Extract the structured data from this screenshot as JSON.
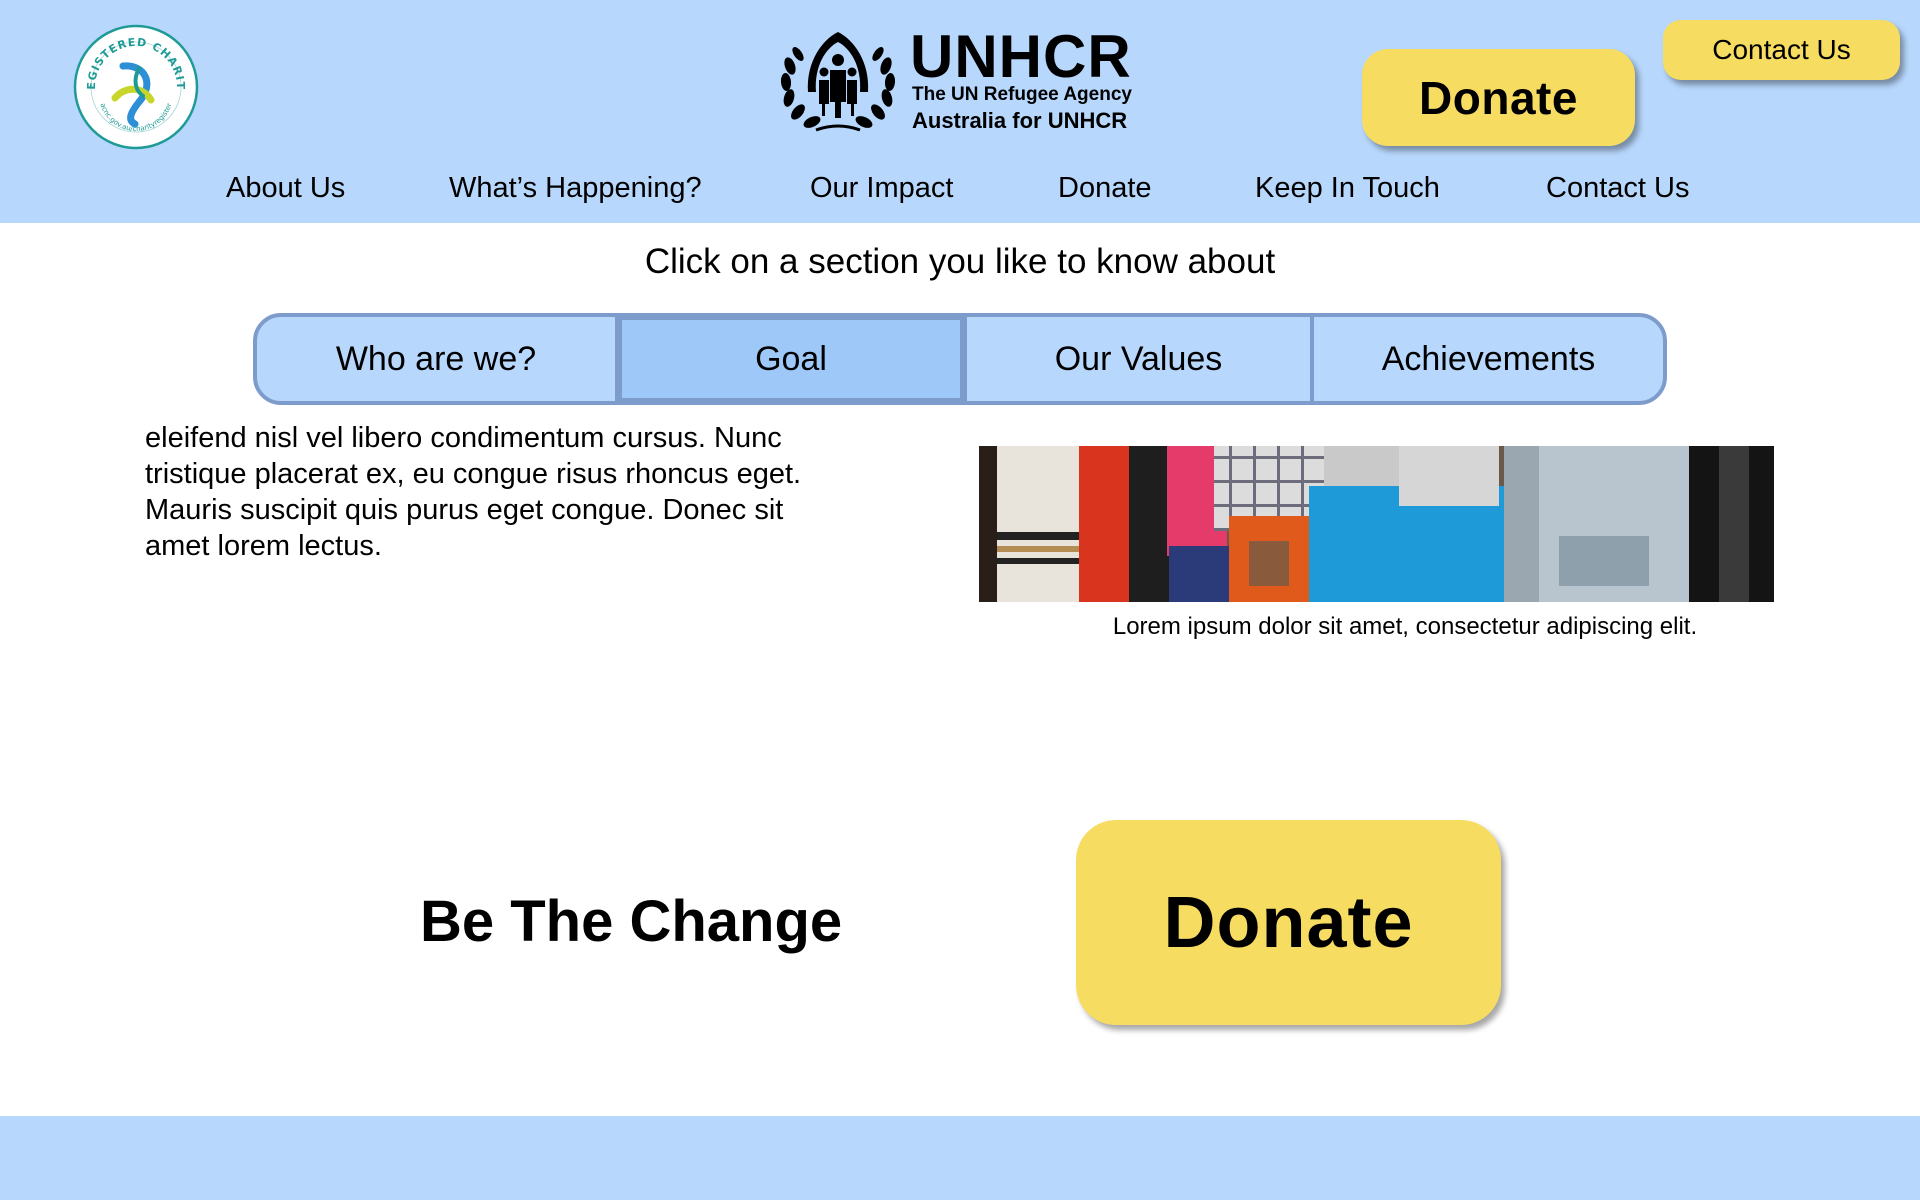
{
  "header": {
    "charity_badge": {
      "icon": "registered-charity-seal",
      "text": "REGISTERED CHARITY",
      "url_text": "acnc.gov.au/charityregister"
    },
    "logo": {
      "icon": "unhcr-emblem",
      "title": "UNHCR",
      "subtitle_1": "The UN Refugee Agency",
      "subtitle_2": "Australia for UNHCR"
    },
    "donate_label": "Donate",
    "contact_label": "Contact Us",
    "nav": [
      "About Us",
      "What’s Happening?",
      "Our Impact",
      "Donate",
      "Keep In Touch",
      "Contact Us"
    ]
  },
  "main": {
    "section_prompt": "Click on a section you like to know about",
    "tabs": [
      {
        "label": "Who are we?",
        "active": false
      },
      {
        "label": "Goal",
        "active": true
      },
      {
        "label": "Our Values",
        "active": false
      },
      {
        "label": "Achievements",
        "active": false
      }
    ],
    "body_text": "eleifend nisl vel libero condimentum cursus. Nunc tristique placerat ex, eu congue risus rhoncus eget. Mauris suscipit quis purus eget congue. Donec sit amet lorem lectus.",
    "photo_caption": "Lorem ipsum dolor sit amet, consectetur adipiscing elit."
  },
  "cta": {
    "title": "Be The Change",
    "donate_label": "Donate"
  },
  "colors": {
    "header_bg": "#b7d7fc",
    "button_yellow": "#f7dc62",
    "tab_active": "#9ec8f8",
    "tab_border": "#7d9ccc"
  }
}
